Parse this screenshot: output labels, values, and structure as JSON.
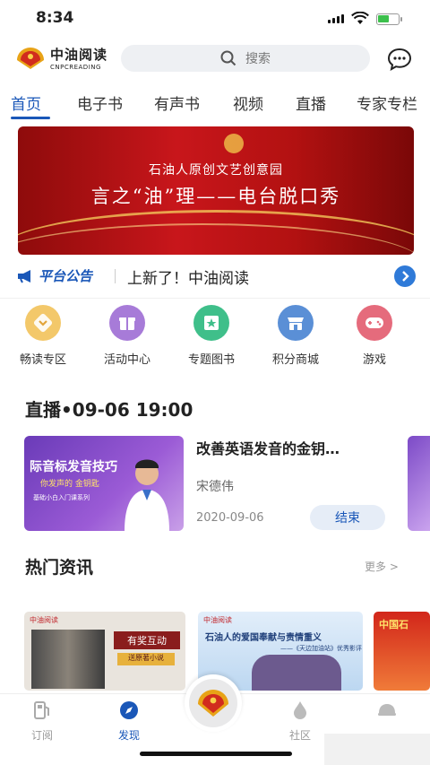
{
  "status": {
    "time": "8:34"
  },
  "header": {
    "logo_title": "中油阅读",
    "logo_sub": "CNPCREADING",
    "search_placeholder": "搜索"
  },
  "tabs": [
    {
      "label": "首页",
      "active": true
    },
    {
      "label": "电子书"
    },
    {
      "label": "有声书"
    },
    {
      "label": "视频"
    },
    {
      "label": "直播"
    },
    {
      "label": "专家专栏"
    }
  ],
  "banner": {
    "line1": "石油人原创文艺创意园",
    "line2": "言之“油”理——电台脱口秀"
  },
  "notice": {
    "tag": "平台公告",
    "text": "上新了！中油阅读"
  },
  "shortcuts": [
    {
      "label": "畅读专区",
      "color": "#f3c86a",
      "icon": "chevron-down-icon"
    },
    {
      "label": "活动中心",
      "color": "#a77bd8",
      "icon": "gift-icon"
    },
    {
      "label": "专题图书",
      "color": "#3fbf8a",
      "icon": "star-book-icon"
    },
    {
      "label": "积分商城",
      "color": "#5a8fd6",
      "icon": "shop-icon"
    },
    {
      "label": "游戏",
      "color": "#e56b7c",
      "icon": "gamepad-icon"
    }
  ],
  "live": {
    "heading": "直播•09-06 19:00",
    "card_title": "际音标发音技巧",
    "card_sub": "你发声的 金钥匙",
    "card_line": "基础小白入门课系列",
    "title": "改善英语发音的金钥…",
    "author": "宋德伟",
    "date": "2020-09-06",
    "status": "结束"
  },
  "news": {
    "heading": "热门资讯",
    "more": "更多 >",
    "items": [
      {
        "brand": "中油阅读",
        "tag": "有奖互动",
        "sub": "送原著小说"
      },
      {
        "brand": "中油阅读",
        "headline": "石油人的爱国奉献与责情重义",
        "sub": "——《天边加油站》优秀影评"
      },
      {
        "headline": "中国石"
      }
    ]
  },
  "tabbar": {
    "items": [
      {
        "label": "订阅"
      },
      {
        "label": "发现",
        "active": true
      },
      {
        "label": "社区"
      },
      {
        "label": ""
      }
    ]
  }
}
